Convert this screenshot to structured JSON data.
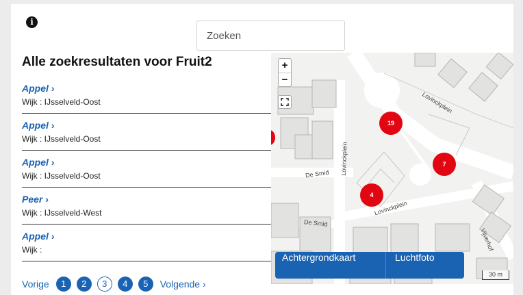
{
  "search": {
    "placeholder": "Zoeken"
  },
  "page_title": "Alle zoekresultaten voor Fruit2",
  "results": [
    {
      "name": "Appel",
      "area": "Wijk : IJsselveld-Oost"
    },
    {
      "name": "Appel",
      "area": "Wijk : IJsselveld-Oost"
    },
    {
      "name": "Appel",
      "area": "Wijk : IJsselveld-Oost"
    },
    {
      "name": "Peer",
      "area": "Wijk : IJsselveld-West"
    },
    {
      "name": "Appel",
      "area": "Wijk :"
    }
  ],
  "result_chevron": "›",
  "pagination": {
    "previous": "Vorige",
    "pages": [
      "1",
      "2",
      "3",
      "4",
      "5"
    ],
    "current": "3",
    "next": "Volgende ›"
  },
  "map": {
    "zoom_in": "+",
    "zoom_out": "−",
    "clusters": [
      "19",
      "7",
      "4"
    ],
    "streets": [
      "Lovinckplein",
      "De Smid",
      "Lovinckplein",
      "Lovinckplein",
      "De Smid",
      "Vijverhof"
    ],
    "layers": {
      "base": "Achtergrondkaart",
      "aerial": "Luchtfoto"
    },
    "scale_label": "30 m",
    "cluster_color": "#e20613"
  },
  "colors": {
    "accent": "#1a63b3"
  },
  "icons": {
    "info": "info-icon",
    "fullscreen": "fullscreen-icon"
  }
}
